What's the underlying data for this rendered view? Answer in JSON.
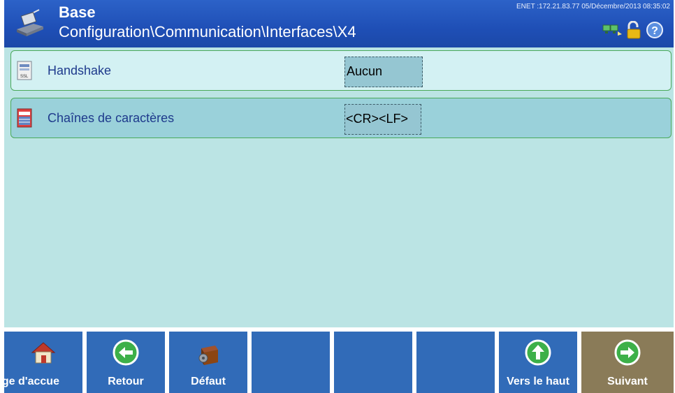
{
  "header": {
    "title": "Base",
    "path": "Configuration\\Communication\\Interfaces\\X4",
    "status": "ENET :172.21.83.77  05/Décembre/2013 08:35:02",
    "icons": [
      "network-icon",
      "lock-icon",
      "help-icon"
    ]
  },
  "rows": [
    {
      "label": "Handshake",
      "value": "Aucun",
      "icon": "ssl-file-icon"
    },
    {
      "label": "Chaînes de caractères",
      "value": "<CR><LF>",
      "icon": "document-icon"
    }
  ],
  "softkeys": [
    {
      "label": "age d'accue",
      "icon": "home-icon"
    },
    {
      "label": "Retour",
      "icon": "arrow-left-icon"
    },
    {
      "label": "Défaut",
      "icon": "default-box-icon"
    },
    {
      "label": ""
    },
    {
      "label": ""
    },
    {
      "label": ""
    },
    {
      "label": "Vers le haut",
      "icon": "arrow-up-icon"
    },
    {
      "label": "Suivant",
      "icon": "arrow-right-icon"
    }
  ],
  "colors": {
    "header": "#2c62c8",
    "content_bg": "#bbe4e4",
    "softkey": "#316bb8",
    "softkey_next": "#8a7b58",
    "row_border": "#4aa95a"
  }
}
